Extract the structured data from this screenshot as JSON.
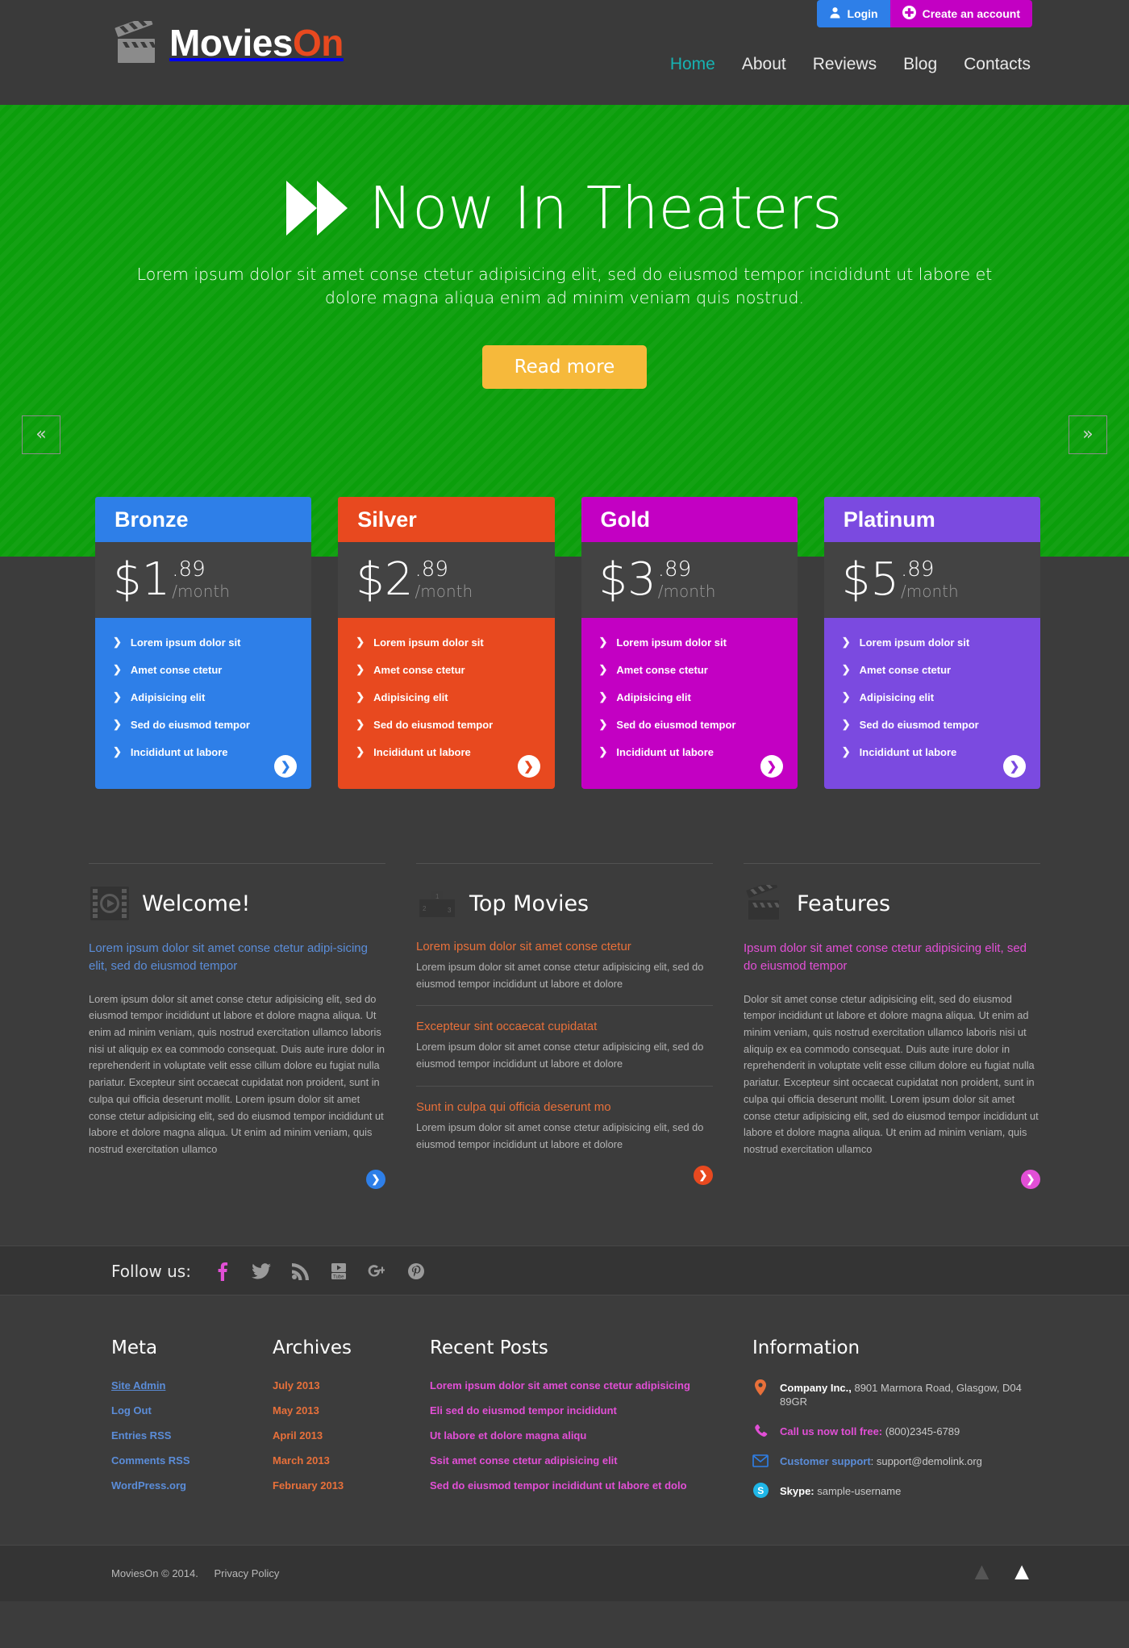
{
  "header": {
    "logo": {
      "icon": "clapperboard-icon",
      "text_primary": "Movies",
      "text_accent": "On"
    },
    "auth": {
      "login_label": "Login",
      "login_icon": "user-icon",
      "register_label": "Create an account",
      "register_icon": "plus-circle-icon"
    },
    "nav": [
      {
        "label": "Home",
        "active": true
      },
      {
        "label": "About",
        "active": false
      },
      {
        "label": "Reviews",
        "active": false
      },
      {
        "label": "Blog",
        "active": false
      },
      {
        "label": "Contacts",
        "active": false
      }
    ]
  },
  "hero": {
    "icon": "fast-forward-icon",
    "title": "Now In Theaters",
    "description": "Lorem ipsum dolor sit amet conse ctetur adipisicing elit, sed do eiusmod tempor incididunt ut labore et dolore magna aliqua enim ad minim veniam quis nostrud.",
    "button_label": "Read more",
    "prev_label": "«",
    "next_label": "»",
    "bg_color": "#0b9e0b",
    "button_color": "#f6b93b"
  },
  "pricing": [
    {
      "name": "Bronze",
      "color": "#2e7fe8",
      "currency": "$",
      "amount": "1",
      "cents": ".89",
      "period": "/month",
      "features": [
        "Lorem ipsum dolor sit",
        "Amet conse ctetur",
        "Adipisicing elit",
        "Sed do eiusmod tempor",
        "Incididunt ut labore"
      ],
      "go_label": "❯"
    },
    {
      "name": "Silver",
      "color": "#e8491f",
      "currency": "$",
      "amount": "2",
      "cents": ".89",
      "period": "/month",
      "features": [
        "Lorem ipsum dolor sit",
        "Amet conse ctetur",
        "Adipisicing elit",
        "Sed do eiusmod tempor",
        "Incididunt ut labore"
      ],
      "go_label": "❯"
    },
    {
      "name": "Gold",
      "color": "#c300c3",
      "currency": "$",
      "amount": "3",
      "cents": ".89",
      "period": "/month",
      "features": [
        "Lorem ipsum dolor sit",
        "Amet conse ctetur",
        "Adipisicing elit",
        "Sed do eiusmod tempor",
        "Incididunt ut labore"
      ],
      "go_label": "❯"
    },
    {
      "name": "Platinum",
      "color": "#7b4ae0",
      "currency": "$",
      "amount": "5",
      "cents": ".89",
      "period": "/month",
      "features": [
        "Lorem ipsum dolor sit",
        "Amet conse ctetur",
        "Adipisicing elit",
        "Sed do eiusmod tempor",
        "Incididunt ut labore"
      ],
      "go_label": "❯"
    }
  ],
  "columns": {
    "welcome": {
      "icon": "film-strip-play-icon",
      "title": "Welcome!",
      "lead": "Lorem ipsum dolor sit amet conse ctetur adipi-sicing elit, sed do eiusmod tempor",
      "body": "Lorem ipsum dolor sit amet conse ctetur adipisicing elit, sed do eiusmod tempor incididunt ut labore et dolore magna aliqua. Ut enim ad minim veniam, quis nostrud exercitation ullamco laboris nisi ut aliquip ex ea commodo consequat. Duis aute irure dolor in reprehenderit in voluptate velit esse cillum dolore eu fugiat nulla pariatur. Excepteur sint occaecat cupidatat non proident, sunt in culpa qui officia deserunt mollit. Lorem ipsum dolor sit amet conse ctetur adipisicing elit, sed do eiusmod tempor incididunt ut labore et dolore magna aliqua. Ut enim ad minim veniam, quis nostrud exercitation ullamco",
      "go_label": "❯",
      "accent": "#2e7fe8"
    },
    "top_movies": {
      "icon": "podium-icon",
      "title": "Top Movies",
      "go_label": "❯",
      "accent": "#e8491f",
      "posts": [
        {
          "title": "Lorem ipsum dolor sit amet conse ctetur",
          "text": "Lorem ipsum dolor sit amet conse ctetur adipisicing elit, sed do eiusmod tempor incididunt ut labore et dolore"
        },
        {
          "title": "Excepteur sint occaecat cupidatat",
          "text": "Lorem ipsum dolor sit amet conse ctetur adipisicing elit, sed do eiusmod tempor incididunt ut labore et dolore"
        },
        {
          "title": "Sunt in culpa qui officia deserunt mo",
          "text": "Lorem ipsum dolor sit amet conse ctetur adipisicing elit, sed do eiusmod tempor incididunt ut labore et dolore"
        }
      ]
    },
    "features": {
      "icon": "clapperboard-icon",
      "title": "Features",
      "lead": "Ipsum dolor sit amet conse ctetur adipisicing elit, sed do eiusmod tempor",
      "body": "Dolor sit amet conse ctetur adipisicing elit, sed do eiusmod tempor incididunt ut labore et dolore magna aliqua. Ut enim ad minim veniam, quis nostrud exercitation ullamco laboris nisi ut aliquip ex ea commodo consequat. Duis aute irure dolor in reprehenderit in voluptate velit esse cillum dolore eu fugiat nulla pariatur. Excepteur sint occaecat cupidatat non proident, sunt in culpa qui officia deserunt mollit. Lorem ipsum dolor sit amet conse ctetur adipisicing elit, sed do eiusmod tempor incididunt ut labore et dolore magna aliqua. Ut enim ad minim veniam, quis nostrud exercitation ullamco",
      "go_label": "❯",
      "accent": "#e24fd6"
    }
  },
  "follow": {
    "label": "Follow us:",
    "icons": [
      {
        "name": "facebook-icon",
        "glyph": "f",
        "color": "#e24fd6"
      },
      {
        "name": "twitter-icon",
        "glyph": "",
        "color": "#9a9a9a"
      },
      {
        "name": "rss-icon",
        "glyph": "",
        "color": "#9a9a9a"
      },
      {
        "name": "youtube-icon",
        "glyph": "",
        "color": "#9a9a9a"
      },
      {
        "name": "google-plus-icon",
        "glyph": "",
        "color": "#9a9a9a"
      },
      {
        "name": "pinterest-icon",
        "glyph": "",
        "color": "#9a9a9a"
      }
    ]
  },
  "footer": {
    "meta": {
      "title": "Meta",
      "links": [
        "Site Admin",
        "Log Out",
        "Entries RSS",
        "Comments RSS",
        "WordPress.org"
      ]
    },
    "archives": {
      "title": "Archives",
      "links": [
        "July 2013",
        "May 2013",
        "April 2013",
        "March 2013",
        "February 2013"
      ]
    },
    "recent_posts": {
      "title": "Recent Posts",
      "links": [
        "Lorem ipsum dolor sit amet conse ctetur adipisicing",
        "Eli sed do eiusmod tempor incididunt",
        "Ut labore et dolore magna aliqu",
        "Ssit amet conse ctetur adipisicing elit",
        "Sed do eiusmod tempor incididunt ut labore et dolo"
      ]
    },
    "information": {
      "title": "Information",
      "rows": [
        {
          "icon": "map-pin-icon",
          "key": "Company Inc.,",
          "value": " 8901 Marmora Road, Glasgow, D04 89GR",
          "key_class": "k-white"
        },
        {
          "icon": "phone-icon",
          "key": "Call us now toll free:",
          "value": " (800)2345-6789",
          "key_class": "k-magenta"
        },
        {
          "icon": "envelope-icon",
          "key": "Customer support",
          "value": ": support@demolink.org",
          "key_class": "k-blue"
        },
        {
          "icon": "skype-icon",
          "key": "Skype:",
          "value": " sample-username",
          "key_class": "k-white"
        }
      ]
    }
  },
  "copyright": {
    "text": "MoviesOn © 2014.",
    "privacy_label": "Privacy Policy",
    "to_top_icon": "chevron-up-icon"
  }
}
